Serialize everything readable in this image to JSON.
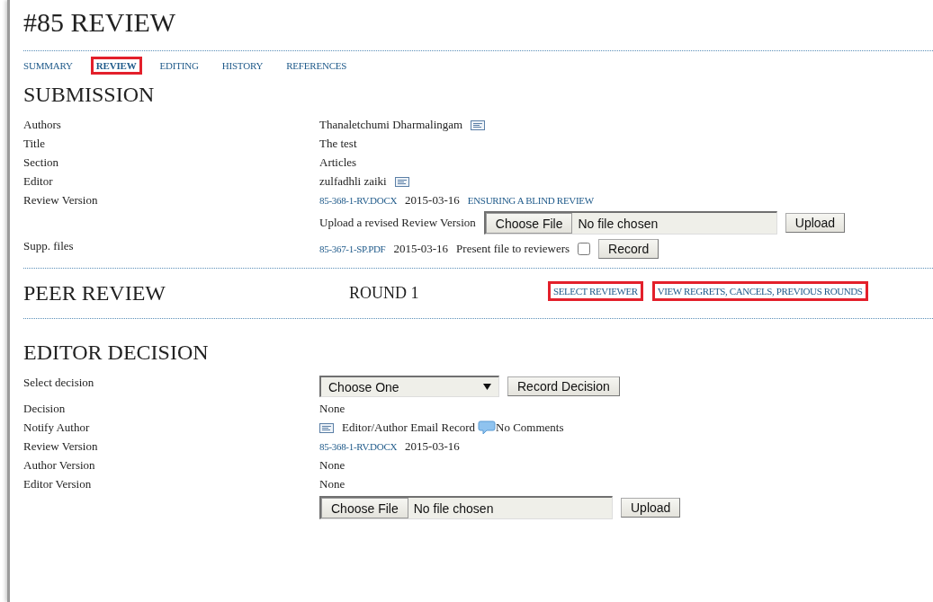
{
  "page_title": "#85 REVIEW",
  "tabs": [
    {
      "label": "SUMMARY",
      "selected": false,
      "highlighted": false
    },
    {
      "label": "REVIEW",
      "selected": true,
      "highlighted": true
    },
    {
      "label": "EDITING",
      "selected": false,
      "highlighted": false
    },
    {
      "label": "HISTORY",
      "selected": false,
      "highlighted": false
    },
    {
      "label": "REFERENCES",
      "selected": false,
      "highlighted": false
    }
  ],
  "submission": {
    "heading": "SUBMISSION",
    "rows": [
      {
        "label": "Authors",
        "lines": [
          [
            {
              "kind": "text",
              "text": "Thanaletchumi Dharmalingam"
            },
            {
              "kind": "email"
            }
          ]
        ]
      },
      {
        "label": "Title",
        "lines": [
          [
            {
              "kind": "text",
              "text": "The test"
            }
          ]
        ]
      },
      {
        "label": "Section",
        "lines": [
          [
            {
              "kind": "text",
              "text": "Articles"
            }
          ]
        ]
      },
      {
        "label": "Editor",
        "lines": [
          [
            {
              "kind": "text",
              "text": "zulfadhli zaiki"
            },
            {
              "kind": "email"
            }
          ]
        ]
      },
      {
        "label": "Review Version",
        "lines": [
          [
            {
              "kind": "link",
              "text": "85-368-1-RV.DOCX"
            },
            {
              "kind": "text",
              "text": "2015-03-16"
            },
            {
              "kind": "link",
              "text": "ENSURING A BLIND REVIEW"
            }
          ],
          [
            {
              "kind": "text",
              "text": "Upload a revised Review Version"
            },
            {
              "kind": "file_input",
              "button": "Choose File",
              "status": "No file chosen"
            },
            {
              "kind": "button",
              "text": "Upload"
            }
          ]
        ]
      },
      {
        "label": "Supp. files",
        "lines": [
          [
            {
              "kind": "link",
              "text": "85-367-1-SP.PDF"
            },
            {
              "kind": "text",
              "text": "2015-03-16"
            },
            {
              "kind": "text",
              "text": "Present file to reviewers"
            },
            {
              "kind": "checkbox",
              "checked": false
            },
            {
              "kind": "button",
              "text": "Record"
            }
          ]
        ]
      }
    ]
  },
  "peer_review": {
    "heading": "PEER REVIEW",
    "round": "ROUND 1",
    "links": [
      {
        "label": "SELECT REVIEWER",
        "highlighted": true
      },
      {
        "label": "VIEW REGRETS, CANCELS, PREVIOUS ROUNDS",
        "highlighted": true
      }
    ]
  },
  "editor_decision": {
    "heading": "EDITOR DECISION",
    "rows": [
      {
        "label": "Select decision",
        "lines": [
          [
            {
              "kind": "select",
              "value": "Choose One"
            },
            {
              "kind": "button",
              "text": "Record Decision"
            }
          ]
        ]
      },
      {
        "label": "Decision",
        "lines": [
          [
            {
              "kind": "text",
              "text": "None"
            }
          ]
        ]
      },
      {
        "label": "Notify Author",
        "lines": [
          [
            {
              "kind": "email"
            },
            {
              "kind": "text",
              "text": "Editor/Author Email Record"
            },
            {
              "kind": "comment",
              "text": "No Comments"
            }
          ]
        ]
      },
      {
        "label": "Review Version",
        "lines": [
          [
            {
              "kind": "link",
              "text": "85-368-1-RV.DOCX"
            },
            {
              "kind": "text",
              "text": "2015-03-16"
            }
          ]
        ]
      },
      {
        "label": "Author Version",
        "lines": [
          [
            {
              "kind": "text",
              "text": "None"
            }
          ]
        ]
      },
      {
        "label": "Editor Version",
        "lines": [
          [
            {
              "kind": "text",
              "text": "None"
            }
          ]
        ]
      },
      {
        "label": "",
        "lines": [
          [
            {
              "kind": "file_input",
              "button": "Choose File",
              "status": "No file chosen"
            },
            {
              "kind": "button",
              "text": "Upload"
            }
          ]
        ]
      }
    ]
  }
}
